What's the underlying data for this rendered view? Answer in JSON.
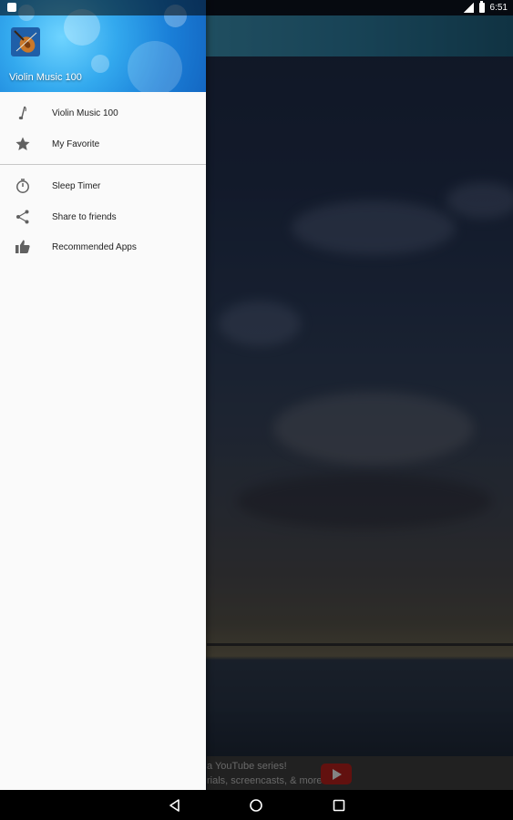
{
  "status_bar": {
    "time": "6:51"
  },
  "drawer": {
    "header_title": "Violin Music 100",
    "items": [
      {
        "label": "Violin Music 100",
        "icon": "music-note-icon"
      },
      {
        "label": "My Favorite",
        "icon": "star-icon"
      },
      {
        "label": "Sleep Timer",
        "icon": "timer-icon"
      },
      {
        "label": "Share to friends",
        "icon": "share-icon"
      },
      {
        "label": "Recommended Apps",
        "icon": "thumb-up-icon"
      }
    ]
  },
  "ad_banner": {
    "line1": "a YouTube series!",
    "line2": "rials, screencasts, & more."
  },
  "colors": {
    "header_blue": "#33a9ee",
    "drawer_bg": "#fafafa",
    "ad_play_red": "#b3201c"
  }
}
